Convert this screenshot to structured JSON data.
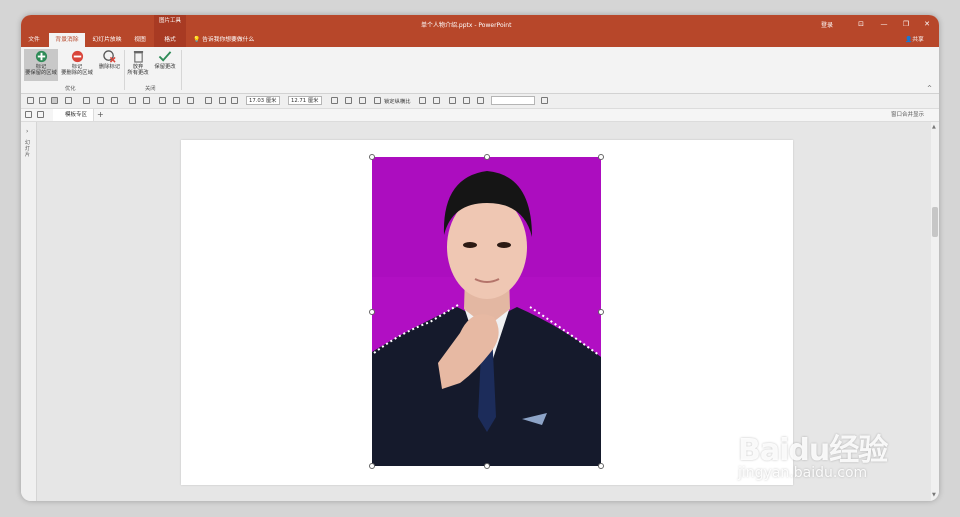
{
  "colors": {
    "accent": "#b7472a",
    "context": "#a83a23",
    "photo_bg": "#b10fc3"
  },
  "titlebar": {
    "context_group": "图片工具",
    "doc_title": "单个人物介绍.pptx - PowerPoint",
    "login": "登录",
    "controls": [
      "⊡",
      "—",
      "❐",
      "✕"
    ]
  },
  "tabs": [
    {
      "label": "文件",
      "active": false
    },
    {
      "label": "背景消除",
      "active": true
    },
    {
      "label": "幻灯片放映",
      "active": false
    },
    {
      "label": "视图",
      "active": false
    },
    {
      "label": "格式",
      "active": false
    }
  ],
  "tell_me": "告诉我你想要做什么",
  "share": "共享",
  "ribbon": {
    "mark_keep": {
      "line1": "标记",
      "line2": "要保留的区域"
    },
    "mark_remove": {
      "line1": "标记",
      "line2": "要删除的区域"
    },
    "delete_mark": "删除标记",
    "discard": {
      "line1": "放弃",
      "line2": "所有更改"
    },
    "keep_changes": "保留更改",
    "group_refine": "优化",
    "group_close": "关闭"
  },
  "toolbar": {
    "height_value": "17.03 厘米",
    "width_value": "12.71 厘米",
    "lock_ratio": "锁定纵横比"
  },
  "docbar": {
    "tab_label": "模板专区",
    "plus": "+",
    "merge": "窗口合并显示"
  },
  "leftpane": {
    "label": "幻灯片"
  },
  "watermark": {
    "logo": "Baidu经验",
    "url": "jingyan.baidu.com"
  }
}
